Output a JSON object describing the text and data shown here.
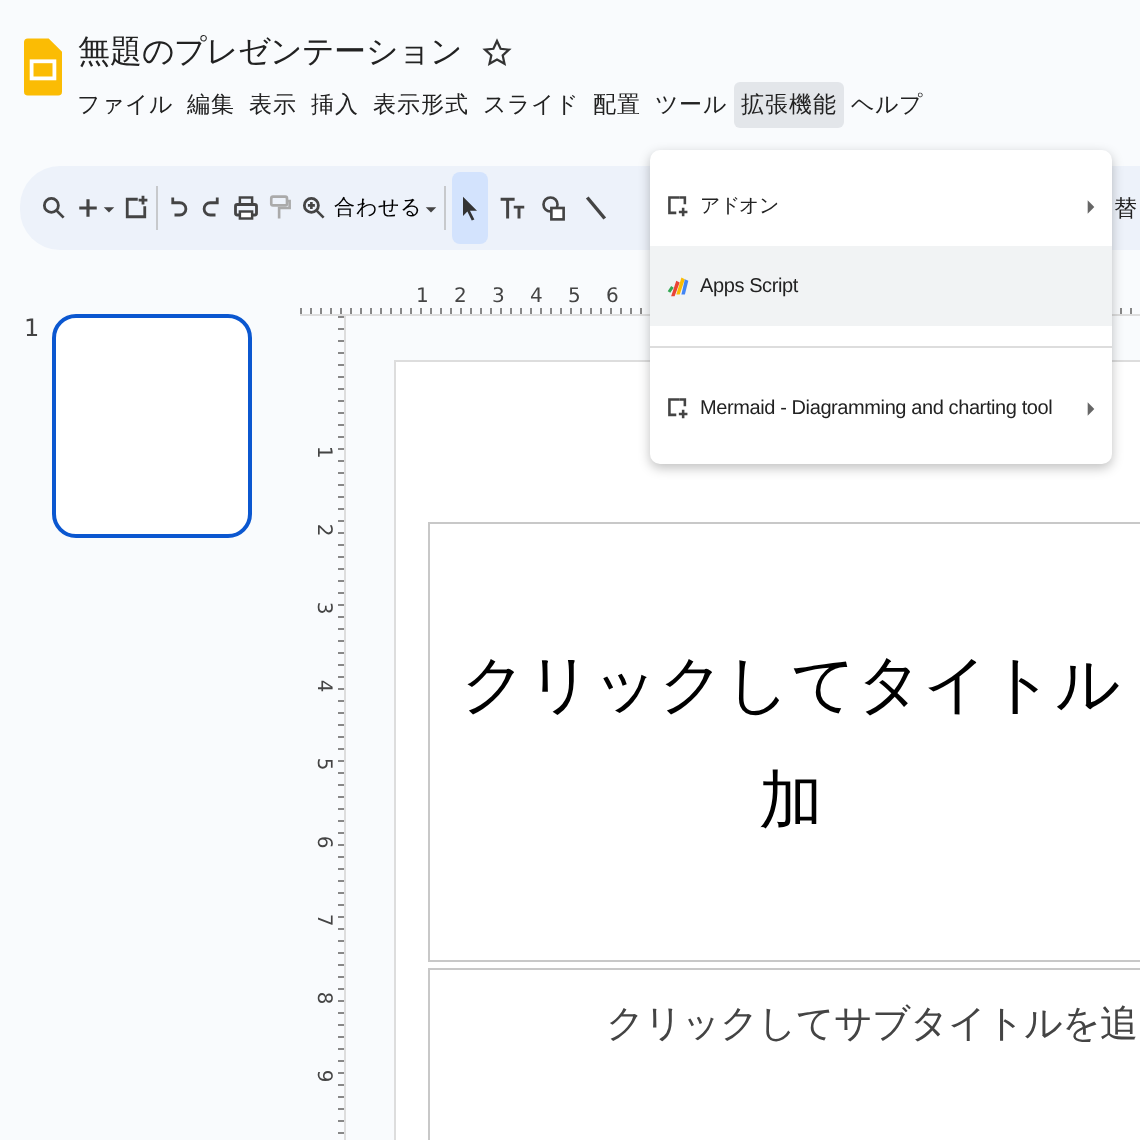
{
  "document": {
    "title": "無題のプレゼンテーション",
    "starred": false
  },
  "menu": [
    {
      "label": "ファイル",
      "selected": false
    },
    {
      "label": "編集",
      "selected": false
    },
    {
      "label": "表示",
      "selected": false
    },
    {
      "label": "挿入",
      "selected": false
    },
    {
      "label": "表示形式",
      "selected": false
    },
    {
      "label": "スライド",
      "selected": false
    },
    {
      "label": "配置",
      "selected": false
    },
    {
      "label": "ツール",
      "selected": false
    },
    {
      "label": "拡張機能",
      "selected": true
    },
    {
      "label": "ヘルプ",
      "selected": false
    }
  ],
  "toolbar": {
    "zoom_label": "合わせる",
    "tools": [
      {
        "kind": "select",
        "selected": true
      },
      {
        "kind": "text",
        "selected": false
      },
      {
        "kind": "shape",
        "selected": false
      },
      {
        "kind": "line",
        "selected": false
      }
    ],
    "trailing_text": "替"
  },
  "dropdown": {
    "items": [
      {
        "kind": "addon",
        "label": "アドオン",
        "submenu": true,
        "selected": false
      },
      {
        "kind": "script",
        "label": "Apps Script",
        "submenu": false,
        "selected": true
      },
      {
        "kind": "divider"
      },
      {
        "kind": "addon",
        "label": "Mermaid - Diagramming and charting tool",
        "submenu": true,
        "selected": false
      }
    ]
  },
  "filmstrip": [
    {
      "number": "1",
      "selected": true
    }
  ],
  "ruler": {
    "horizontal": [
      "1",
      "2",
      "3",
      "4",
      "5",
      "6"
    ],
    "vertical": [
      "1",
      "2",
      "3",
      "4",
      "5",
      "6",
      "7",
      "8",
      "9"
    ]
  },
  "slide": {
    "title_lines": [
      "クリックしてタイトル",
      "加"
    ],
    "subtitle": "クリックしてサブタイトルを追"
  }
}
